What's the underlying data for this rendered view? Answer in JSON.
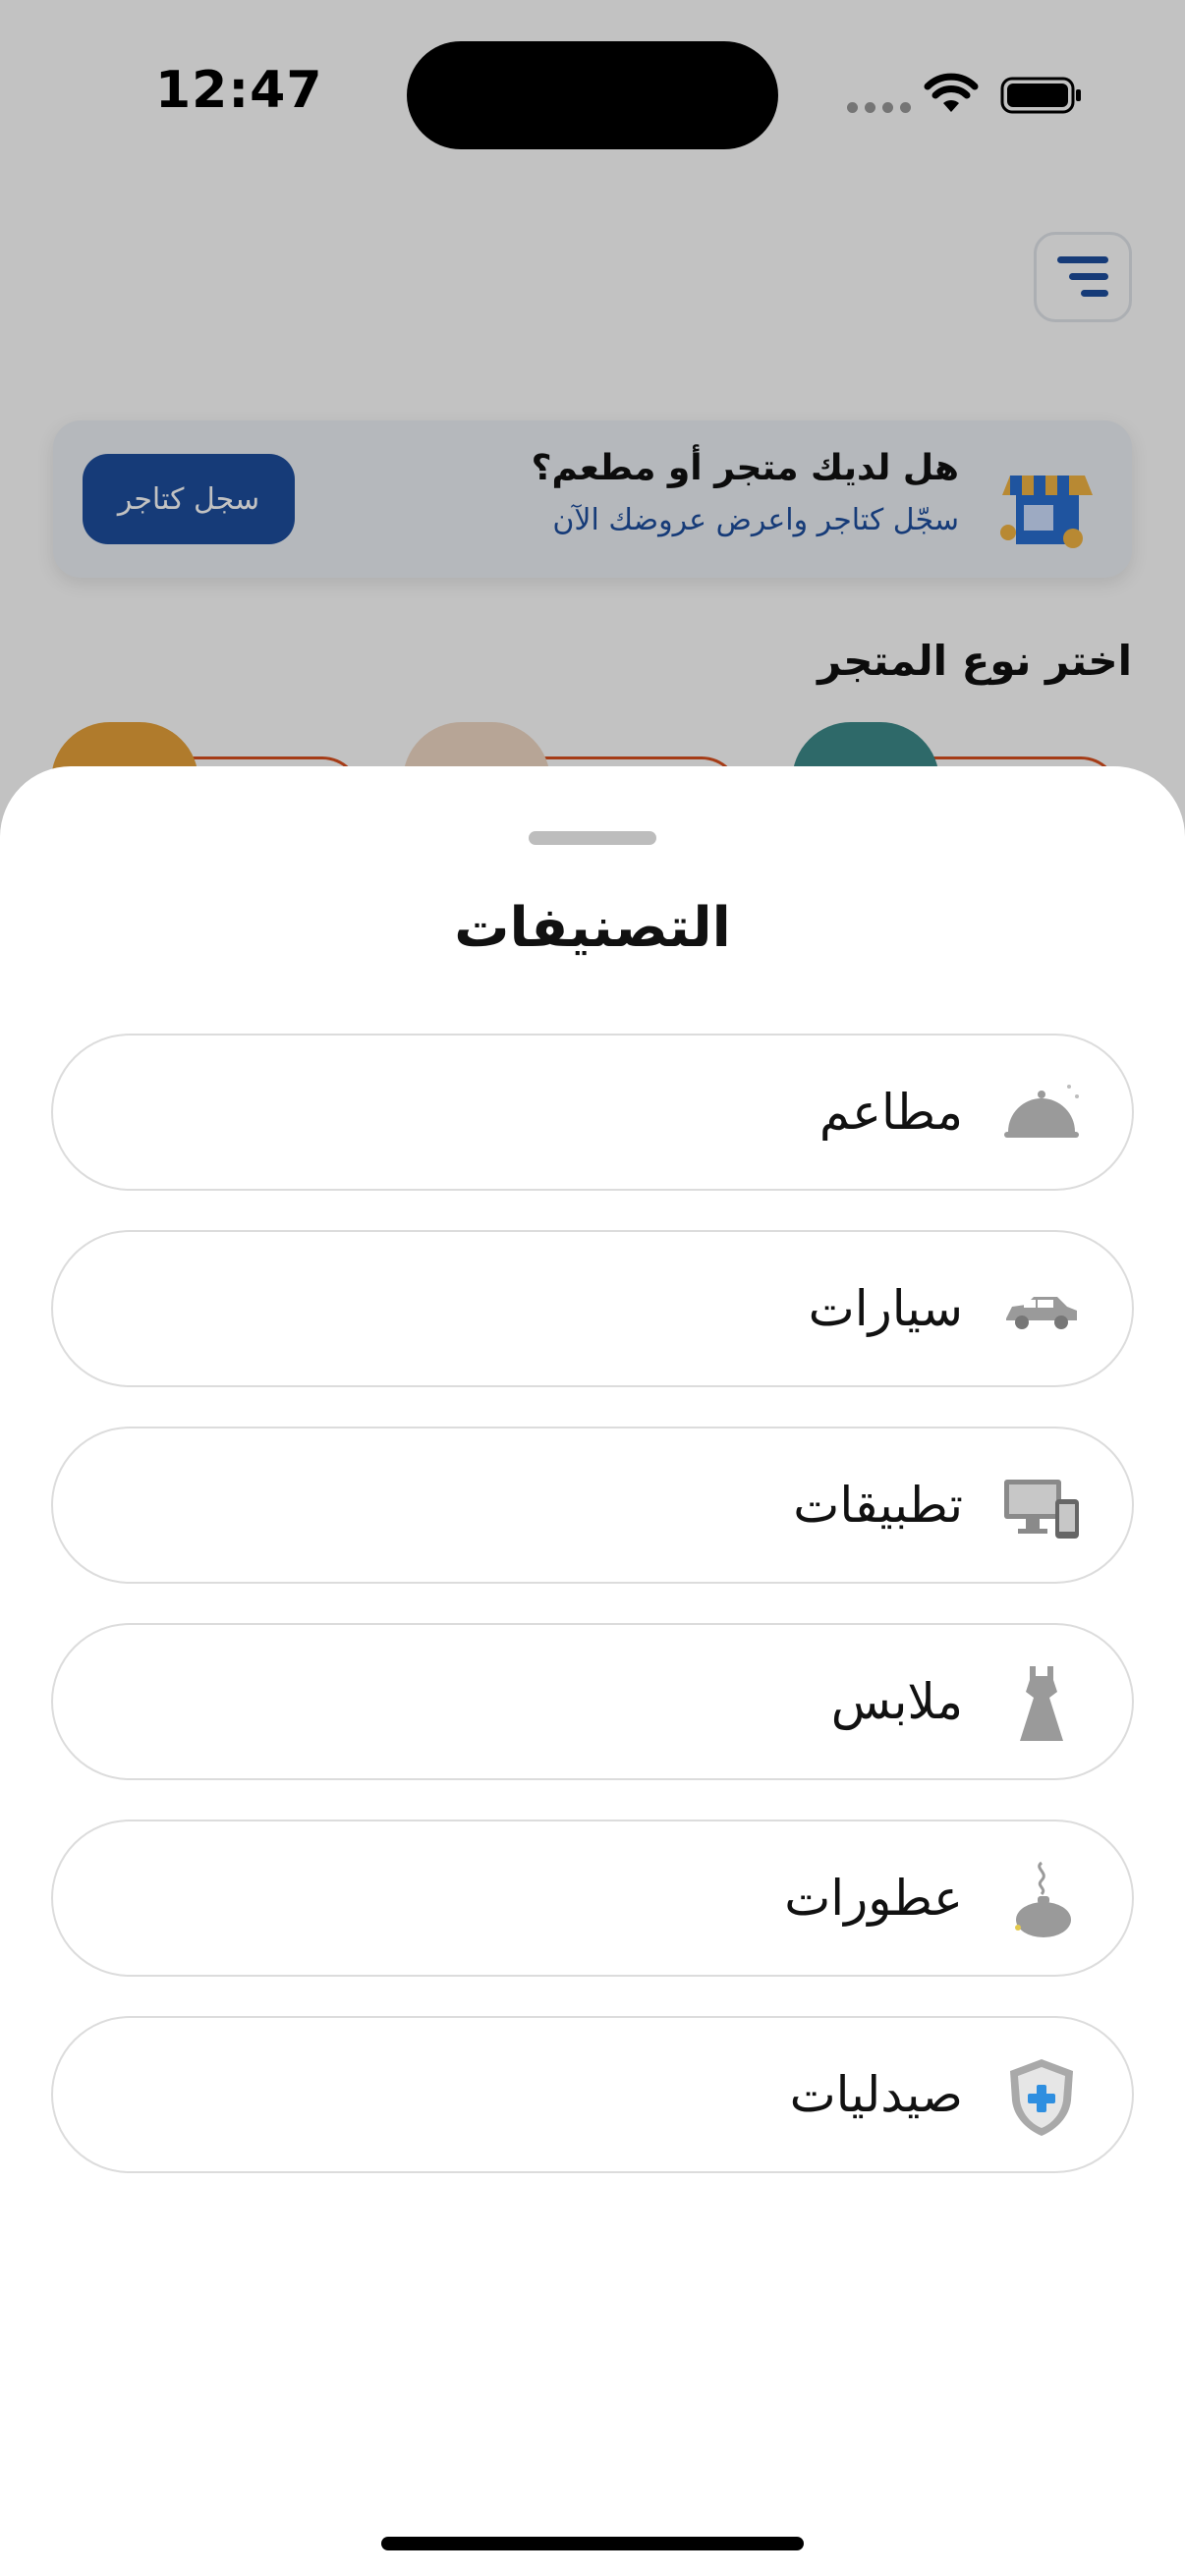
{
  "status_bar": {
    "time": "12:47"
  },
  "merchant_banner": {
    "title": "هل لديك متجر أو مطعم؟",
    "subtitle": "سجّل كتاجر واعرض عروضك الآن",
    "button_label": "سجل كتاجر"
  },
  "store_section": {
    "title": "اختر نوع المتجر"
  },
  "sheet": {
    "title": "التصنيفات",
    "categories": [
      {
        "label": "مطاعم",
        "icon": "restaurant-cloche-icon"
      },
      {
        "label": "سيارات",
        "icon": "car-icon"
      },
      {
        "label": "تطبيقات",
        "icon": "devices-icon"
      },
      {
        "label": "ملابس",
        "icon": "dress-icon"
      },
      {
        "label": "عطورات",
        "icon": "incense-burner-icon"
      },
      {
        "label": "صيدليات",
        "icon": "medical-shield-icon"
      }
    ]
  },
  "colors": {
    "accent": "#1d4e9e",
    "store_card_border": "#d9501f"
  }
}
